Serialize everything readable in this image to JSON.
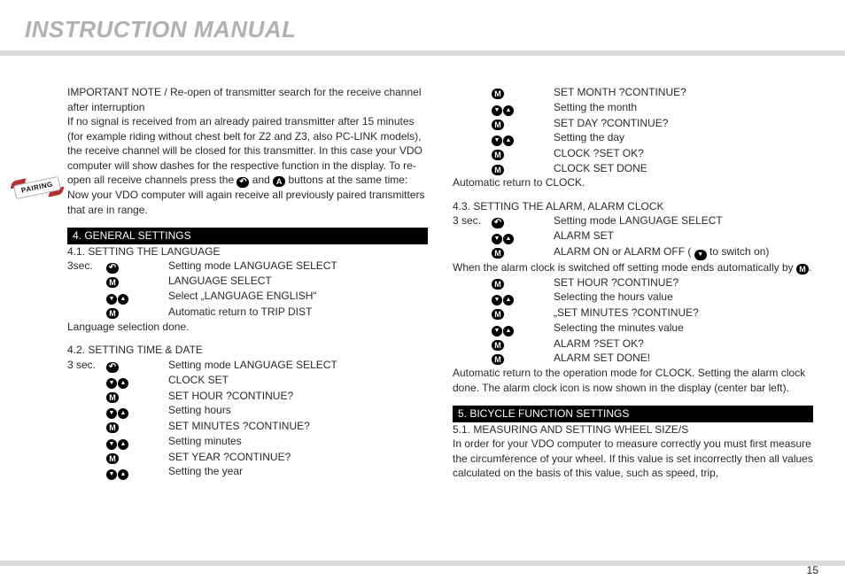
{
  "header": {
    "title": "INSTRUCTION MANUAL"
  },
  "page_number": "15",
  "badge": {
    "text": "PAIRING"
  },
  "left": {
    "intro_heading": "IMPORTANT NOTE / Re-open of transmitter search for the receive channel after interruption",
    "intro_body_a": "If no signal is received from an already paired transmitter after 15 minutes (for example riding without chest belt for Z2 and Z3, also PC-LINK models), the receive channel will be closed for this transmitter. In this case your VDO computer will show dashes for the respective function in the display. To re-open all receive channels press the ",
    "intro_body_b": " and ",
    "intro_body_c": " buttons at the same time: Now your VDO computer will again receive all previously paired transmitters that are in range.",
    "section4_bar": "4. GENERAL SETTINGS",
    "s41_title": "4.1. SETTING THE LANGUAGE",
    "s41_rows": [
      {
        "c1": "3sec.",
        "icon": "back",
        "text": "Setting mode LANGUAGE SELECT"
      },
      {
        "c1": "",
        "icon": "M",
        "text": "LANGUAGE SELECT"
      },
      {
        "c1": "",
        "icon": "dnup",
        "text": "Select „LANGUAGE ENGLISH“"
      },
      {
        "c1": "",
        "icon": "M",
        "text": "Automatic return to TRIP DIST"
      }
    ],
    "s41_done": "Language selection done.",
    "s42_title": "4.2. SETTING TIME & DATE",
    "s42_rows": [
      {
        "c1": "3 sec.",
        "icon": "back",
        "text": "Setting mode LANGUAGE SELECT"
      },
      {
        "c1": "",
        "icon": "dnup",
        "text": "CLOCK SET"
      },
      {
        "c1": "",
        "icon": "M",
        "text": "SET HOUR ?CONTINUE?"
      },
      {
        "c1": "",
        "icon": "dnup",
        "text": "Setting hours"
      },
      {
        "c1": "",
        "icon": "M",
        "text": "SET MINUTES ?CONTINUE?"
      },
      {
        "c1": "",
        "icon": "dnup",
        "text": "Setting minutes"
      },
      {
        "c1": "",
        "icon": "M",
        "text": "SET YEAR ?CONTINUE?"
      },
      {
        "c1": "",
        "icon": "dnup",
        "text": "Setting the year"
      }
    ]
  },
  "right": {
    "cont_rows": [
      {
        "c1": "",
        "icon": "M",
        "text": "SET MONTH ?CONTINUE?"
      },
      {
        "c1": "",
        "icon": "dnup",
        "text": "Setting the month"
      },
      {
        "c1": "",
        "icon": "M",
        "text": "SET DAY ?CONTINUE?"
      },
      {
        "c1": "",
        "icon": "dnup",
        "text": "Setting the day"
      },
      {
        "c1": "",
        "icon": "M",
        "text": "CLOCK ?SET OK?"
      },
      {
        "c1": "",
        "icon": "M",
        "text": "CLOCK SET DONE"
      }
    ],
    "auto_return_clock": "Automatic return to CLOCK.",
    "s43_title": "4.3. SETTING THE ALARM, ALARM CLOCK",
    "s43_rows_a": [
      {
        "c1": "3 sec.",
        "icon": "back",
        "text": "Setting mode LANGUAGE SELECT"
      },
      {
        "c1": "",
        "icon": "dnup",
        "text": "ALARM SET"
      }
    ],
    "s43_alarm_on_off_pre": "ALARM ON or ALARM OFF ( ",
    "s43_alarm_on_off_post": " to switch on)",
    "s43_switched_off_pre": "When the alarm clock is switched off setting mode ends automatically by ",
    "s43_switched_off_post": ".",
    "s43_rows_b": [
      {
        "c1": "",
        "icon": "M",
        "text": "SET HOUR ?CONTINUE?"
      },
      {
        "c1": "",
        "icon": "dnup",
        "text": "Selecting the hours value"
      },
      {
        "c1": "",
        "icon": "M",
        "text": "„SET MINUTES ?CONTINUE?"
      },
      {
        "c1": "",
        "icon": "dnup",
        "text": "Selecting the minutes value"
      },
      {
        "c1": "",
        "icon": "M",
        "text": "ALARM ?SET OK?"
      },
      {
        "c1": "",
        "icon": "M",
        "text": "ALARM SET DONE!"
      }
    ],
    "s43_done": "Automatic return to the operation mode for CLOCK. Setting the alarm clock done. The alarm clock icon is now shown in the display (center bar left).",
    "section5_bar": "5. BICYCLE FUNCTION SETTINGS",
    "s51_title": "5.1. MEASURING AND SETTING WHEEL SIZE/S",
    "s51_body": "In order for your VDO computer to measure correctly you must first measure the circumference of your wheel. If this value is set incorrectly then all values calculated on the basis of this value, such as speed, trip,"
  }
}
